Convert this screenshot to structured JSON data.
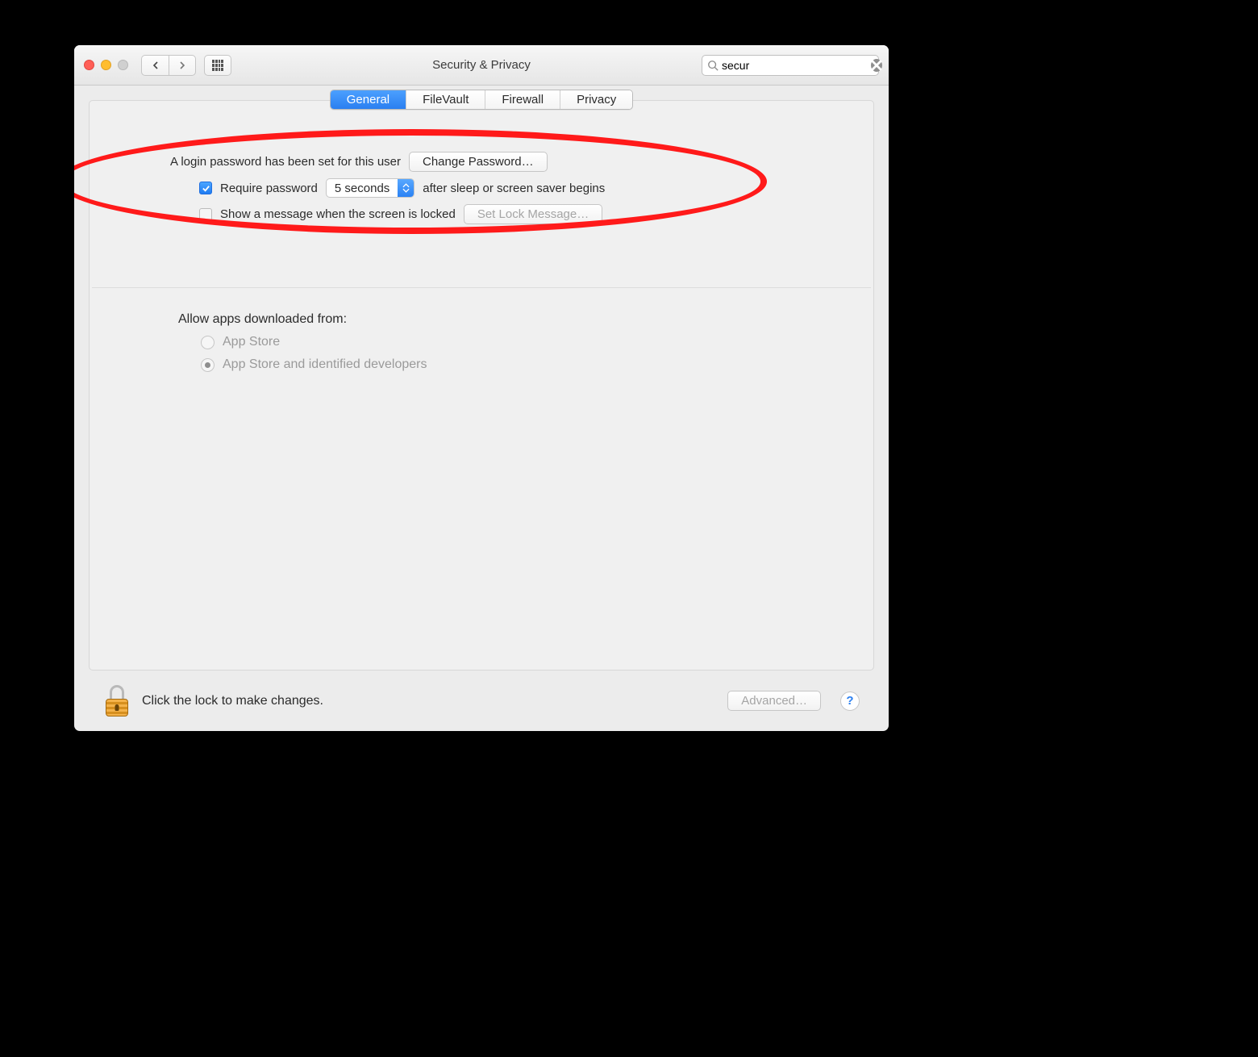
{
  "window": {
    "title": "Security & Privacy"
  },
  "search": {
    "value": "secur"
  },
  "tabs": [
    {
      "label": "General",
      "active": true
    },
    {
      "label": "FileVault",
      "active": false
    },
    {
      "label": "Firewall",
      "active": false
    },
    {
      "label": "Privacy",
      "active": false
    }
  ],
  "general": {
    "login_text": "A login password has been set for this user",
    "change_password_btn": "Change Password…",
    "require_password_label": "Require password",
    "require_password_delay": "5 seconds",
    "require_password_after": "after sleep or screen saver begins",
    "show_message_label": "Show a message when the screen is locked",
    "set_lock_message_btn": "Set Lock Message…",
    "require_password_checked": true,
    "show_message_checked": false
  },
  "allow": {
    "heading": "Allow apps downloaded from:",
    "options": [
      {
        "label": "App Store",
        "selected": false
      },
      {
        "label": "App Store and identified developers",
        "selected": true
      }
    ]
  },
  "footer": {
    "lock_text": "Click the lock to make changes.",
    "advanced_btn": "Advanced…",
    "help": "?"
  }
}
